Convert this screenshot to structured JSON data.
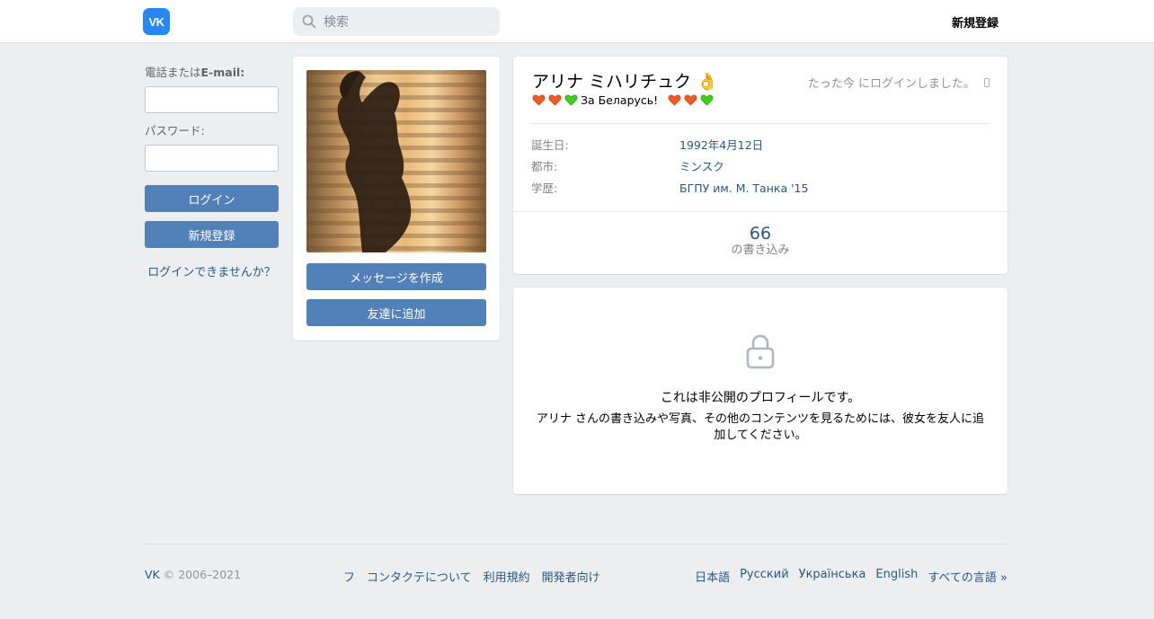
{
  "header": {
    "logo_text": "VK",
    "search_placeholder": "検索",
    "signup_link": "新規登録"
  },
  "login": {
    "phone_label_prefix": "電話または",
    "phone_label_bold": "E-mail:",
    "password_label": "パスワード:",
    "login_button": "ログイン",
    "register_button": "新規登録",
    "forgot_link": "ログインできませんか？"
  },
  "avatar_card": {
    "message_button": "メッセージを作成",
    "add_friend_button": "友達に追加"
  },
  "profile": {
    "name": "アリナ ミハリチュク 👌",
    "status_text": "За Беларусь!",
    "online_text": "たった今 にログインしました。",
    "info": [
      {
        "key": "誕生日:",
        "value": "1992年4月12日"
      },
      {
        "key": "都市:",
        "value": "ミンスク"
      },
      {
        "key": "学歴:",
        "value": "БГПУ им. М. Танка '15"
      }
    ],
    "posts_count": "66",
    "posts_label": "の書き込み"
  },
  "private": {
    "title": "これは非公開のプロフィールです。",
    "text": "アリナ さんの書き込みや写真、その他のコンテンツを見るためには、彼女を友人に追加してください。"
  },
  "footer": {
    "brand": "VK",
    "copyright": "© 2006–2021",
    "links": [
      "フ",
      "コンタクテについて",
      "利用規約",
      "開発者向け"
    ],
    "languages": [
      "日本語",
      "Русский",
      "Українська",
      "English",
      "すべての言語 »"
    ]
  },
  "colors": {
    "accent": "#5181b8",
    "link": "#2a5885",
    "background": "#edeef0",
    "logo": "#2787f5"
  }
}
